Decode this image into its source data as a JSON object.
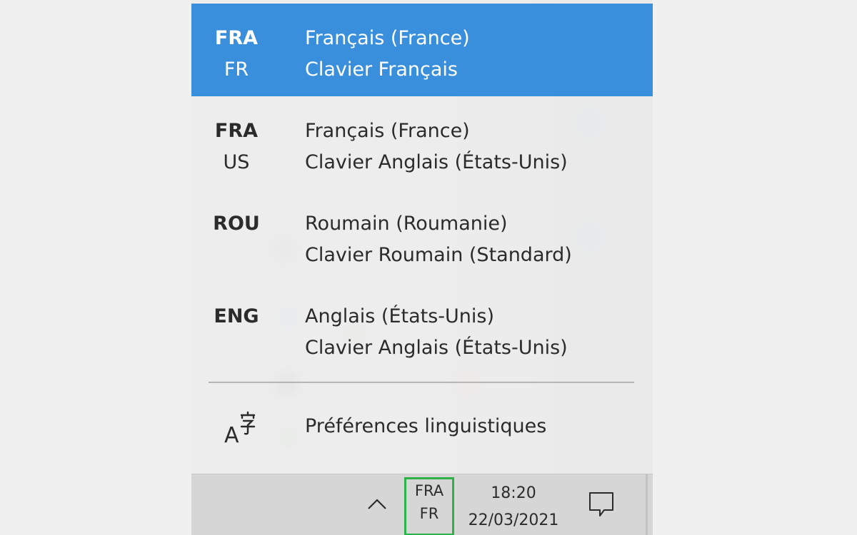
{
  "flyout": {
    "items": [
      {
        "code": "FRA",
        "sub": "FR",
        "language": "Français (France)",
        "keyboard": "Clavier Français",
        "selected": true
      },
      {
        "code": "FRA",
        "sub": "US",
        "language": "Français (France)",
        "keyboard": "Clavier Anglais (États-Unis)",
        "selected": false
      },
      {
        "code": "ROU",
        "sub": "",
        "language": "Roumain (Roumanie)",
        "keyboard": "Clavier Roumain (Standard)",
        "selected": false
      },
      {
        "code": "ENG",
        "sub": "",
        "language": "Anglais (États-Unis)",
        "keyboard": "Clavier Anglais (États-Unis)",
        "selected": false
      }
    ],
    "preferences": {
      "label": "Préférences linguistiques",
      "icon": "language-preferences-icon"
    }
  },
  "taskbar": {
    "language_indicator": {
      "code": "FRA",
      "sub": "FR"
    },
    "clock": {
      "time": "18:20",
      "date": "22/03/2021"
    },
    "icons": [
      "show-hidden-icons-chevron-icon",
      "action-center-icon"
    ]
  },
  "colors": {
    "selected_bg": "#3a8fdd",
    "indicator_border": "#2db24a"
  }
}
